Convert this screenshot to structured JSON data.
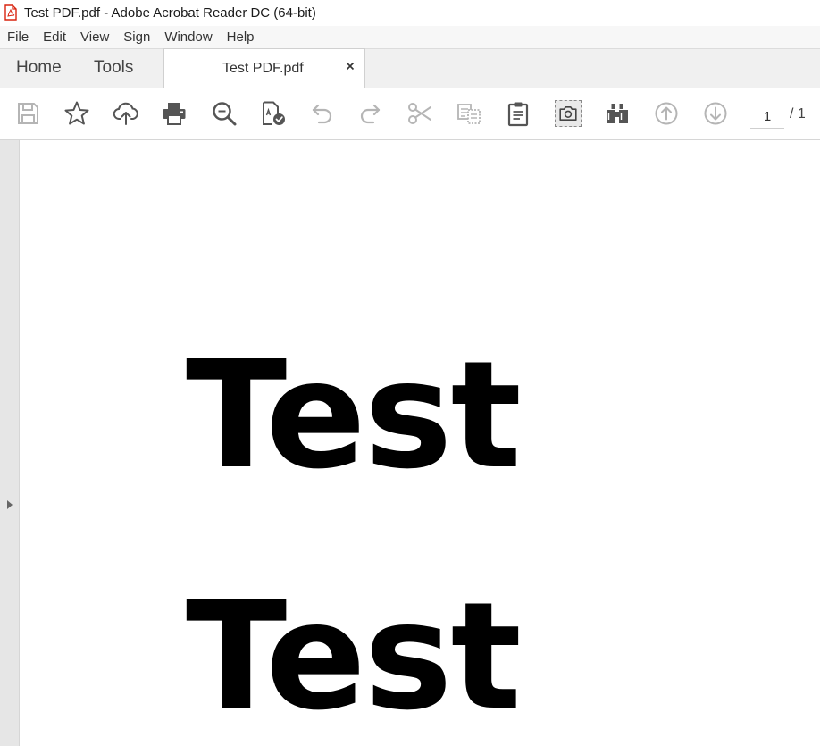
{
  "window": {
    "title": "Test PDF.pdf - Adobe Acrobat Reader DC (64-bit)",
    "icon": "pdf-file-icon"
  },
  "menubar": {
    "items": [
      "File",
      "Edit",
      "View",
      "Sign",
      "Window",
      "Help"
    ]
  },
  "tabs": {
    "home": "Home",
    "tools": "Tools",
    "document": "Test PDF.pdf",
    "close": "×"
  },
  "toolbar": {
    "icons": [
      "save-icon",
      "star-icon",
      "cloud-upload-icon",
      "print-icon",
      "zoom-icon",
      "spellcheck-icon",
      "undo-icon",
      "redo-icon",
      "cut-icon",
      "copy-icon",
      "paste-icon",
      "snapshot-icon",
      "find-icon",
      "page-up-icon",
      "page-down-icon"
    ],
    "page_current": "1",
    "page_total": "/ 1"
  },
  "document": {
    "lines": [
      "Test",
      "Test"
    ]
  },
  "colors": {
    "pdf_red": "#d9230f",
    "icon_gray": "#555555",
    "icon_disabled": "#b5b5b5"
  }
}
